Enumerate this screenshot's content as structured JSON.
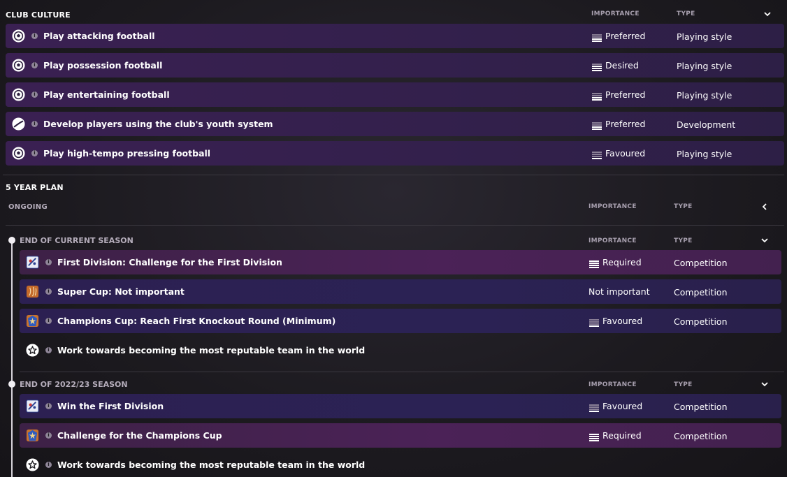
{
  "club_culture": {
    "title": "CLUB CULTURE",
    "col_importance": "IMPORTANCE",
    "col_type": "TYPE",
    "items": [
      {
        "icon": "football-icon",
        "label": "Play attacking football",
        "importance": "Preferred",
        "importance_level": 2,
        "type": "Playing style"
      },
      {
        "icon": "football-icon",
        "label": "Play possession football",
        "importance": "Desired",
        "importance_level": 3,
        "type": "Playing style"
      },
      {
        "icon": "football-icon",
        "label": "Play entertaining football",
        "importance": "Preferred",
        "importance_level": 2,
        "type": "Playing style"
      },
      {
        "icon": "youth-development-icon",
        "label": "Develop players using the club's youth system",
        "importance": "Preferred",
        "importance_level": 2,
        "type": "Development"
      },
      {
        "icon": "football-icon",
        "label": "Play high-tempo pressing football",
        "importance": "Favoured",
        "importance_level": 1,
        "type": "Playing style"
      }
    ]
  },
  "five_year_plan": {
    "title": "5 YEAR PLAN",
    "ongoing_label": "ONGOING",
    "col_importance": "IMPORTANCE",
    "col_type": "TYPE",
    "groups": [
      {
        "title": "END OF CURRENT SEASON",
        "col_importance": "IMPORTANCE",
        "col_type": "TYPE",
        "items": [
          {
            "icon": "league-trophy-icon",
            "label": "First Division: Challenge for the First Division",
            "importance": "Required",
            "importance_level": 4,
            "type": "Competition"
          },
          {
            "icon": "cup-trophy-icon",
            "label": "Super Cup: Not important",
            "importance": "Not important",
            "importance_level": 0,
            "type": "Competition"
          },
          {
            "icon": "champions-cup-icon",
            "label": "Champions Cup: Reach First Knockout Round (Minimum)",
            "importance": "Favoured",
            "importance_level": 1,
            "type": "Competition"
          },
          {
            "icon": "star-icon",
            "label": "Work towards becoming the most reputable team in the world",
            "importance": "",
            "importance_level": -1,
            "type": ""
          }
        ]
      },
      {
        "title": "END OF 2022/23 SEASON",
        "col_importance": "IMPORTANCE",
        "col_type": "TYPE",
        "items": [
          {
            "icon": "league-trophy-icon",
            "label": "Win the First Division",
            "importance": "Favoured",
            "importance_level": 1,
            "type": "Competition"
          },
          {
            "icon": "champions-cup-icon",
            "label": "Challenge for the Champions Cup",
            "importance": "Required",
            "importance_level": 4,
            "type": "Competition"
          },
          {
            "icon": "star-icon",
            "label": "Work towards becoming the most reputable team in the world",
            "importance": "",
            "importance_level": -1,
            "type": ""
          }
        ]
      }
    ]
  }
}
